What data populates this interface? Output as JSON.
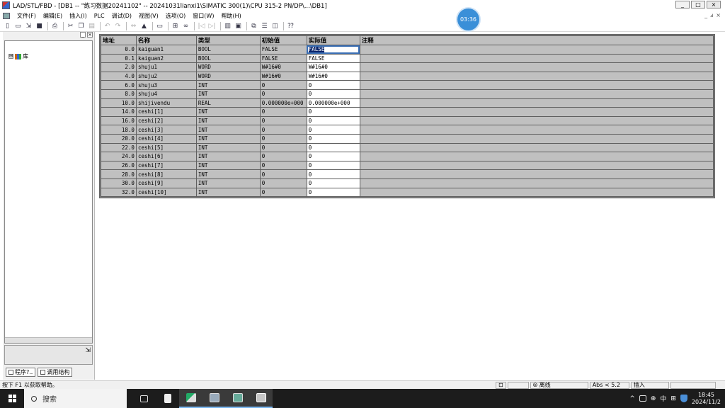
{
  "window": {
    "title": "LAD/STL/FBD  - [DB1 -- \"练习数据20241102\" -- 20241031lianxi1\\SIMATIC 300(1)\\CPU 315-2 PN/DP\\...\\DB1]",
    "min": "_",
    "max": "□",
    "close": "×"
  },
  "menu": [
    "文件(F)",
    "编辑(E)",
    "插入(I)",
    "PLC",
    "调试(D)",
    "视图(V)",
    "选项(O)",
    "窗口(W)",
    "帮助(H)"
  ],
  "mdi_controls": {
    "min": "_",
    "restore": "ⅎ",
    "close": "×"
  },
  "timer": "03:36",
  "tree": {
    "expander": "⊞",
    "library": "库"
  },
  "panel_tabs": [
    "程序?..",
    "调用结构"
  ],
  "grid": {
    "headers": [
      "地址",
      "名称",
      "类型",
      "初始值",
      "实际值",
      "注释"
    ],
    "rows": [
      [
        "0.0",
        "kaiguan1",
        "BOOL",
        "FALSE",
        "FALSE",
        ""
      ],
      [
        "0.1",
        "kaiguan2",
        "BOOL",
        "FALSE",
        "FALSE",
        ""
      ],
      [
        "2.0",
        "shuju1",
        "WORD",
        "W#16#0",
        "W#16#0",
        ""
      ],
      [
        "4.0",
        "shuju2",
        "WORD",
        "W#16#0",
        "W#16#0",
        ""
      ],
      [
        "6.0",
        "shuju3",
        "INT",
        "0",
        "0",
        ""
      ],
      [
        "8.0",
        "shuju4",
        "INT",
        "0",
        "0",
        ""
      ],
      [
        "10.0",
        "shijivendu",
        "REAL",
        "0.000000e+000",
        "0.000000e+000",
        ""
      ],
      [
        "14.0",
        "ceshi[1]",
        "INT",
        "0",
        "0",
        ""
      ],
      [
        "16.0",
        "ceshi[2]",
        "INT",
        "0",
        "0",
        ""
      ],
      [
        "18.0",
        "ceshi[3]",
        "INT",
        "0",
        "0",
        ""
      ],
      [
        "20.0",
        "ceshi[4]",
        "INT",
        "0",
        "0",
        ""
      ],
      [
        "22.0",
        "ceshi[5]",
        "INT",
        "0",
        "0",
        ""
      ],
      [
        "24.0",
        "ceshi[6]",
        "INT",
        "0",
        "0",
        ""
      ],
      [
        "26.0",
        "ceshi[7]",
        "INT",
        "0",
        "0",
        ""
      ],
      [
        "28.0",
        "ceshi[8]",
        "INT",
        "0",
        "0",
        ""
      ],
      [
        "30.0",
        "ceshi[9]",
        "INT",
        "0",
        "0",
        ""
      ],
      [
        "32.0",
        "ceshi[10]",
        "INT",
        "0",
        "0",
        ""
      ]
    ],
    "selected_row": 0
  },
  "status": {
    "help": "按下 F1 以获取帮助。",
    "mode": "离线",
    "abs": "Abs < 5.2",
    "insert": "插入"
  },
  "taskbar": {
    "search": "搜索",
    "ime": "中",
    "time": "18:45",
    "date": "2024/11/2"
  }
}
